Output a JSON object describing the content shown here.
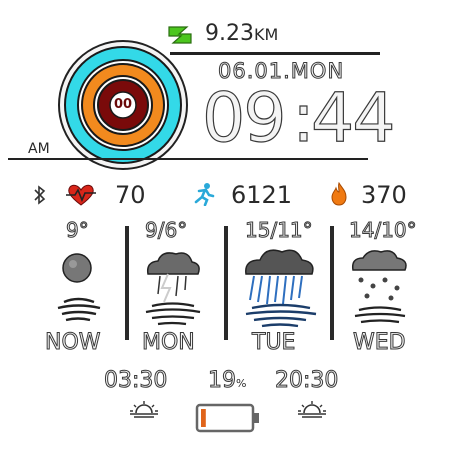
{
  "distance": {
    "value": "9.23",
    "unit": "KM"
  },
  "date": "06.01.MON",
  "time": {
    "hours": "09",
    "minutes": "44",
    "ampm": "AM"
  },
  "ring_label": "00",
  "stats": {
    "heart_rate": "70",
    "steps": "6121",
    "calories": "370"
  },
  "forecast": [
    {
      "temp": "9°",
      "day": "NOW",
      "icon": "moon-cloud-icon"
    },
    {
      "temp": "9/6°",
      "day": "MON",
      "icon": "thunderstorm-icon"
    },
    {
      "temp": "15/11°",
      "day": "TUE",
      "icon": "heavy-rain-icon"
    },
    {
      "temp": "14/10°",
      "day": "WED",
      "icon": "hail-icon"
    }
  ],
  "sun": {
    "sunrise": "03:30",
    "humidity": "19",
    "humidity_unit": "%",
    "sunset": "20:30"
  },
  "battery": {
    "level": 0.1
  },
  "colors": {
    "ring_cyan": "#33d9e8",
    "ring_orange": "#f28a1e",
    "ring_red": "#7a0a0a",
    "accent_green": "#4cc61e",
    "accent_blue": "#2aa9d9",
    "heart_red": "#d9261a",
    "flame_orange": "#f07a12"
  }
}
